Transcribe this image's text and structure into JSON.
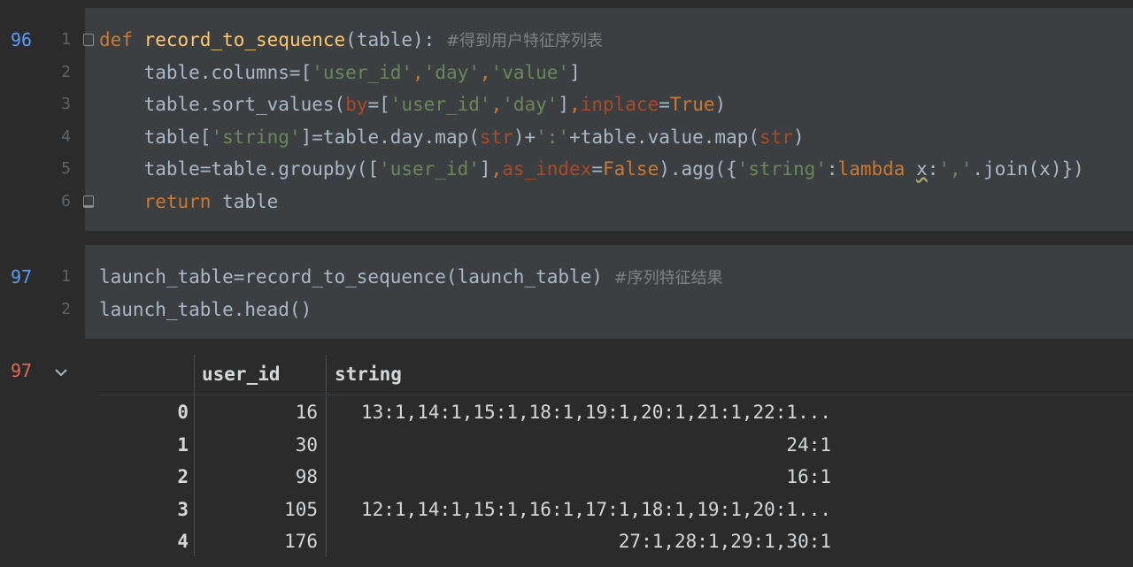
{
  "cells": [
    {
      "exec_count": "96",
      "lines": [
        {
          "n": "1",
          "tokens": [
            {
              "t": "def",
              "c": "kw"
            },
            {
              "t": " ",
              "c": ""
            },
            {
              "t": "record_to_sequence",
              "c": "fn"
            },
            {
              "t": "(table): ",
              "c": ""
            },
            {
              "t": "#得到用户特征序列表",
              "c": "cmt"
            }
          ]
        },
        {
          "n": "2",
          "tokens": [
            {
              "t": "    table.columns=[",
              "c": ""
            },
            {
              "t": "'user_id'",
              "c": "str"
            },
            {
              "t": ",",
              "c": "kw"
            },
            {
              "t": "'day'",
              "c": "str"
            },
            {
              "t": ",",
              "c": "kw"
            },
            {
              "t": "'value'",
              "c": "str"
            },
            {
              "t": "]",
              "c": ""
            }
          ]
        },
        {
          "n": "3",
          "tokens": [
            {
              "t": "    table.sort_values(",
              "c": ""
            },
            {
              "t": "by",
              "c": "param"
            },
            {
              "t": "=[",
              "c": ""
            },
            {
              "t": "'user_id'",
              "c": "str"
            },
            {
              "t": ",",
              "c": "kw"
            },
            {
              "t": "'day'",
              "c": "str"
            },
            {
              "t": "]",
              "c": ""
            },
            {
              "t": ",",
              "c": "kw"
            },
            {
              "t": "inplace",
              "c": "param"
            },
            {
              "t": "=",
              "c": ""
            },
            {
              "t": "True",
              "c": "kw"
            },
            {
              "t": ")",
              "c": ""
            }
          ]
        },
        {
          "n": "4",
          "tokens": [
            {
              "t": "    table[",
              "c": ""
            },
            {
              "t": "'string'",
              "c": "str"
            },
            {
              "t": "]=table.day.map(",
              "c": ""
            },
            {
              "t": "str",
              "c": "param"
            },
            {
              "t": ")+",
              "c": ""
            },
            {
              "t": "':'",
              "c": "str"
            },
            {
              "t": "+table.value.map(",
              "c": ""
            },
            {
              "t": "str",
              "c": "param"
            },
            {
              "t": ")",
              "c": ""
            }
          ]
        },
        {
          "n": "5",
          "tokens": [
            {
              "t": "    table=table.groupby([",
              "c": ""
            },
            {
              "t": "'user_id'",
              "c": "str"
            },
            {
              "t": "]",
              "c": ""
            },
            {
              "t": ",",
              "c": "kw"
            },
            {
              "t": "as_index",
              "c": "param"
            },
            {
              "t": "=",
              "c": ""
            },
            {
              "t": "False",
              "c": "kw"
            },
            {
              "t": ").agg({",
              "c": ""
            },
            {
              "t": "'string'",
              "c": "str"
            },
            {
              "t": ":",
              "c": ""
            },
            {
              "t": "lambda",
              "c": "kw"
            },
            {
              "t": " ",
              "c": ""
            },
            {
              "t": "x",
              "c": "squig"
            },
            {
              "t": ":",
              "c": ""
            },
            {
              "t": "','",
              "c": "str"
            },
            {
              "t": ".join(x)})",
              "c": ""
            }
          ]
        },
        {
          "n": "6",
          "tokens": [
            {
              "t": "    ",
              "c": ""
            },
            {
              "t": "return",
              "c": "kw"
            },
            {
              "t": " table",
              "c": ""
            }
          ]
        }
      ]
    },
    {
      "exec_count": "97",
      "lines": [
        {
          "n": "1",
          "tokens": [
            {
              "t": "launch_table=record_to_sequence(launch_table) ",
              "c": ""
            },
            {
              "t": "#序列特征结果",
              "c": "cmt"
            }
          ]
        },
        {
          "n": "2",
          "tokens": [
            {
              "t": "launch_table.head()",
              "c": ""
            }
          ]
        }
      ]
    }
  ],
  "output": {
    "exec_count": "97",
    "columns": [
      "user_id",
      "string"
    ],
    "rows": [
      {
        "index": "0",
        "user_id": "16",
        "string": "13:1,14:1,15:1,18:1,19:1,20:1,21:1,22:1..."
      },
      {
        "index": "1",
        "user_id": "30",
        "string": "24:1"
      },
      {
        "index": "2",
        "user_id": "98",
        "string": "16:1"
      },
      {
        "index": "3",
        "user_id": "105",
        "string": "12:1,14:1,15:1,16:1,17:1,18:1,19:1,20:1..."
      },
      {
        "index": "4",
        "user_id": "176",
        "string": "27:1,28:1,29:1,30:1"
      }
    ]
  },
  "icons": {
    "collapse": "chevron-down-icon",
    "fold": "fold-marker-icon"
  },
  "colors": {
    "background": "#2b2b2b",
    "cell": "#3c3f41",
    "keyword": "#cc7832",
    "function": "#ffc66d",
    "string": "#6a8759",
    "param": "#aa4926",
    "exec_blue": "#589df6",
    "exec_red": "#e06b56"
  }
}
